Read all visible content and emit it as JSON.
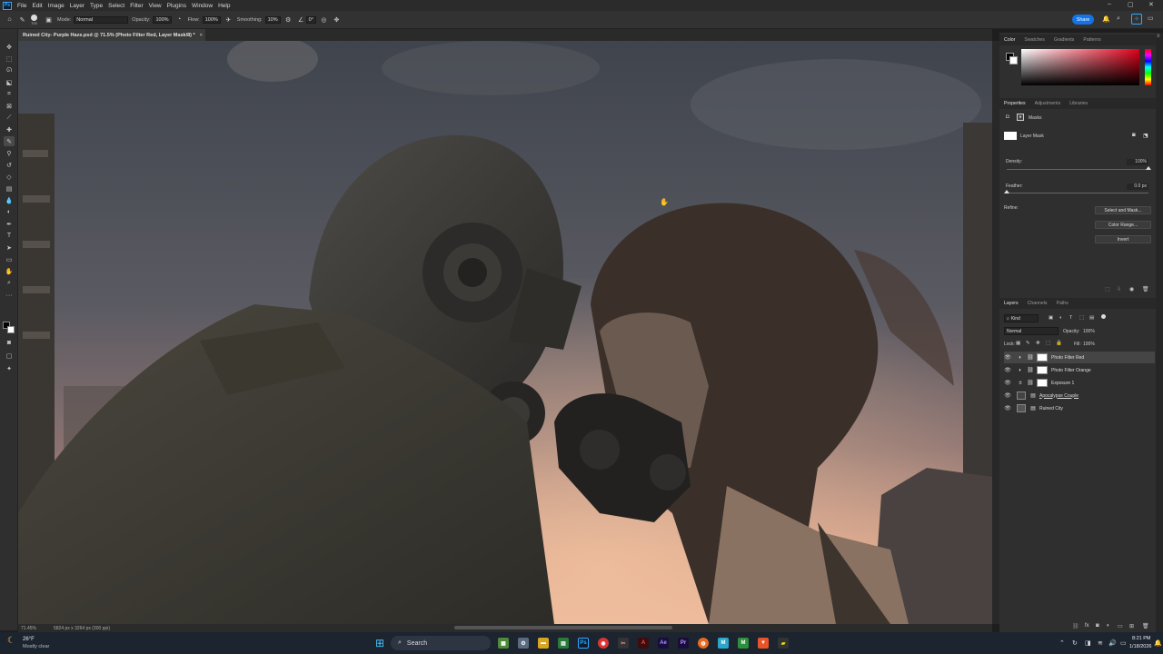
{
  "menubar": {
    "items": [
      "File",
      "Edit",
      "Image",
      "Layer",
      "Type",
      "Select",
      "Filter",
      "View",
      "Plugins",
      "Window",
      "Help"
    ],
    "ps_logo": "Ps"
  },
  "options": {
    "brush_size": "700",
    "mode_label": "Mode:",
    "mode_value": "Normal",
    "opacity_label": "Opacity:",
    "opacity_value": "100%",
    "flow_label": "Flow:",
    "flow_value": "100%",
    "smoothing_label": "Smoothing:",
    "smoothing_value": "10%",
    "angle_value": "0°",
    "share_label": "Share"
  },
  "document": {
    "tab_title": "Ruined City- Purple Haze.psd @ 71.5% (Photo Filter Red, Layer Mask/8) *",
    "zoom": "71.45%",
    "dimensions": "5824 px x 3264 px (300 ppi)"
  },
  "color_panel": {
    "tabs": [
      "Color",
      "Swatches",
      "Gradients",
      "Patterns"
    ]
  },
  "properties_panel": {
    "tabs": [
      "Properties",
      "Adjustments",
      "Libraries"
    ],
    "section_title": "Masks",
    "mask_type": "Layer Mask",
    "density_label": "Density:",
    "density_value": "100%",
    "density_fraction": 1.0,
    "feather_label": "Feather:",
    "feather_value": "0.0 px",
    "feather_fraction": 0.0,
    "refine_label": "Refine:",
    "buttons": [
      "Select and Mask...",
      "Color Range...",
      "Invert"
    ]
  },
  "layers_panel": {
    "tabs": [
      "Layers",
      "Channels",
      "Paths"
    ],
    "kind_label": "Kind",
    "blend_mode": "Normal",
    "opacity_label": "Opacity:",
    "opacity_value": "100%",
    "lock_label": "Lock:",
    "fill_label": "Fill:",
    "fill_value": "100%",
    "layers": [
      {
        "name": "Photo Filter Red",
        "selected": true
      },
      {
        "name": "Photo Filter Orange",
        "selected": false
      },
      {
        "name": "Exposure 1",
        "selected": false
      },
      {
        "name": "Apocalypse Couple",
        "selected": false
      },
      {
        "name": "Ruined City",
        "selected": false
      }
    ]
  },
  "taskbar": {
    "weather_temp": "26°F",
    "weather_desc": "Mostly clear",
    "search_placeholder": "Search",
    "time": "8:21 PM",
    "date": "1/18/2026"
  }
}
